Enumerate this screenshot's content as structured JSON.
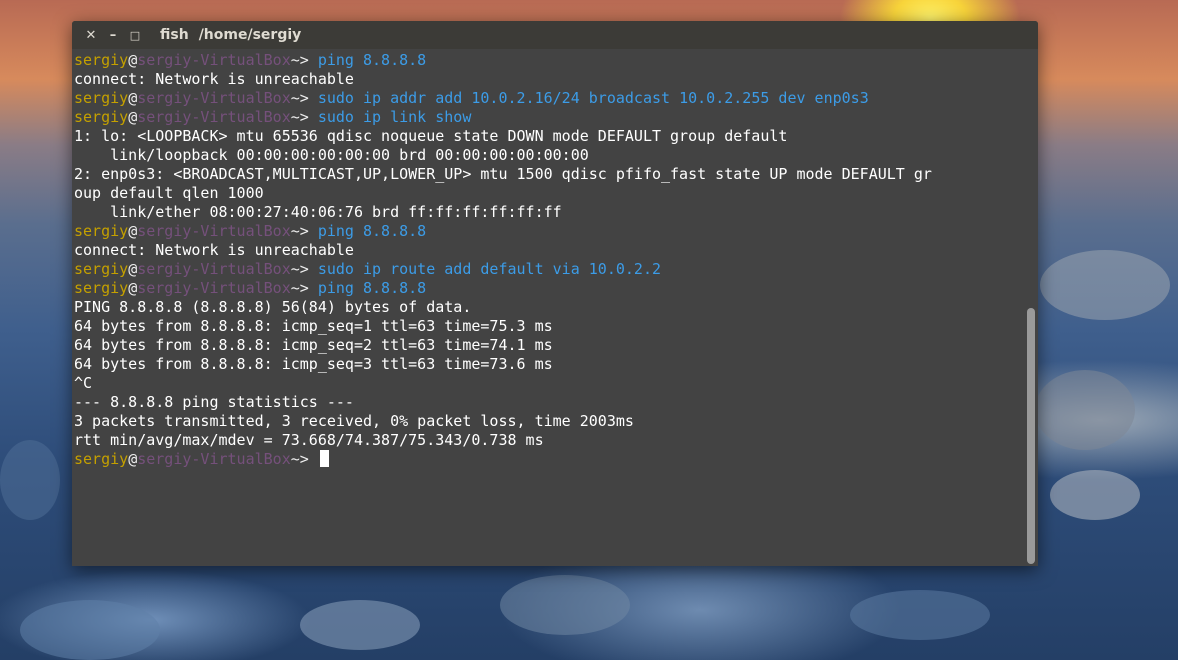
{
  "window": {
    "title": "fish",
    "path": "/home/sergiy",
    "buttons": {
      "close": "✕",
      "minimize": "–",
      "maximize": "□"
    }
  },
  "prompt": {
    "user": "sergiy",
    "at": "@",
    "host": "sergiy-VirtualBox",
    "tilde": "~",
    "symbol": "> "
  },
  "lines": [
    {
      "type": "cmd",
      "text": "ping 8.8.8.8"
    },
    {
      "type": "out",
      "text": "connect: Network is unreachable"
    },
    {
      "type": "cmd",
      "text": "sudo ip addr add 10.0.2.16/24 broadcast 10.0.2.255 dev enp0s3"
    },
    {
      "type": "cmd",
      "text": "sudo ip link show"
    },
    {
      "type": "out",
      "text": "1: lo: <LOOPBACK> mtu 65536 qdisc noqueue state DOWN mode DEFAULT group default"
    },
    {
      "type": "out",
      "text": "    link/loopback 00:00:00:00:00:00 brd 00:00:00:00:00:00"
    },
    {
      "type": "out",
      "text": "2: enp0s3: <BROADCAST,MULTICAST,UP,LOWER_UP> mtu 1500 qdisc pfifo_fast state UP mode DEFAULT gr"
    },
    {
      "type": "out",
      "text": "oup default qlen 1000"
    },
    {
      "type": "out",
      "text": "    link/ether 08:00:27:40:06:76 brd ff:ff:ff:ff:ff:ff"
    },
    {
      "type": "cmd",
      "text": "ping 8.8.8.8"
    },
    {
      "type": "out",
      "text": "connect: Network is unreachable"
    },
    {
      "type": "cmd",
      "text": "sudo ip route add default via 10.0.2.2"
    },
    {
      "type": "cmd",
      "text": "ping 8.8.8.8"
    },
    {
      "type": "out",
      "text": "PING 8.8.8.8 (8.8.8.8) 56(84) bytes of data."
    },
    {
      "type": "out",
      "text": "64 bytes from 8.8.8.8: icmp_seq=1 ttl=63 time=75.3 ms"
    },
    {
      "type": "out",
      "text": "64 bytes from 8.8.8.8: icmp_seq=2 ttl=63 time=74.1 ms"
    },
    {
      "type": "out",
      "text": "64 bytes from 8.8.8.8: icmp_seq=3 ttl=63 time=73.6 ms"
    },
    {
      "type": "out",
      "text": "^C"
    },
    {
      "type": "out",
      "text": "--- 8.8.8.8 ping statistics ---"
    },
    {
      "type": "out",
      "text": "3 packets transmitted, 3 received, 0% packet loss, time 2003ms"
    },
    {
      "type": "out",
      "text": "rtt min/avg/max/mdev = 73.668/74.387/75.343/0.738 ms"
    },
    {
      "type": "prompt",
      "text": ""
    }
  ],
  "colors": {
    "user": "#c4a000",
    "host": "#75507b",
    "command": "#3c9ce7",
    "output": "#ffffff",
    "terminal_bg": "#434343",
    "titlebar_bg": "#3c3b37"
  }
}
